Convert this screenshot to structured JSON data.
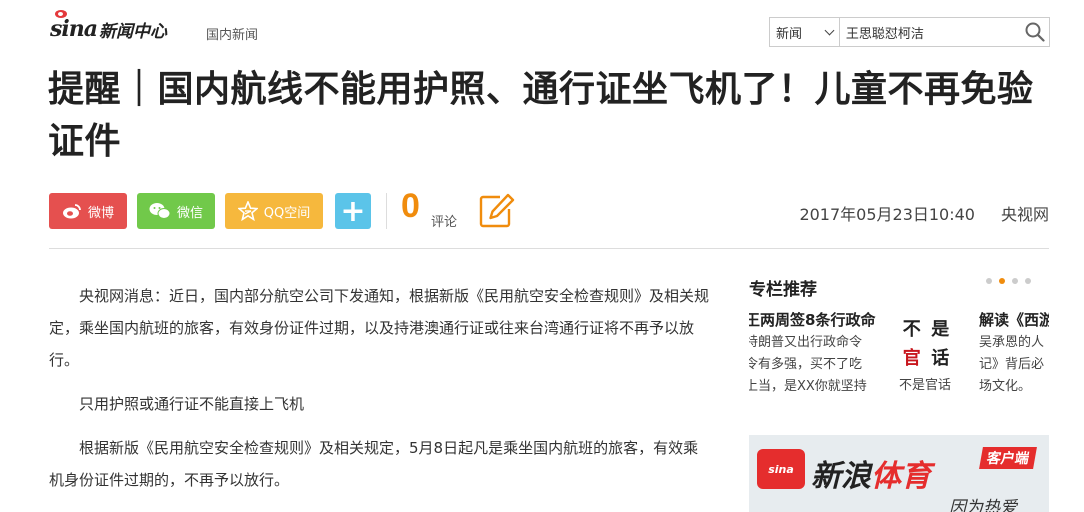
{
  "header": {
    "logo_text": "sina",
    "logo_title": "新闻中心",
    "nav_category": "国内新闻",
    "search": {
      "category": "新闻",
      "query": "王思聪怼柯洁"
    }
  },
  "article": {
    "title": "提醒｜国内航线不能用护照、通行证坐飞机了！儿童不再免验证件",
    "date": "2017年05月23日10:40",
    "source": "央视网",
    "comment_count": "0",
    "comment_label": "评论",
    "paragraphs": [
      "央视网消息：近日，国内部分航空公司下发通知，根据新版《民用航空安全检查规则》及相关规定，乘坐国内航班的旅客，有效身份证件过期，以及持港澳通行证或往来台湾通行证将不再予以放行。",
      "只用护照或通行证不能直接上飞机",
      "根据新版《民用航空安全检查规则》及相关规定，5月8日起凡是乘坐国内航班的旅客，有效乘机身份证件过期的，不再予以放行。"
    ]
  },
  "share": {
    "weibo": "微博",
    "wechat": "微信",
    "qzone": "QQ空间",
    "more": "+"
  },
  "sidebar": {
    "title": "专栏推荐",
    "cards": [
      {
        "headline": "王两周签8条行政命",
        "desc": [
          "特朗普又出行政命令",
          "令有多强，买不了吃",
          "上当，是XX你就坚持"
        ]
      },
      {
        "seal_chars": [
          "不",
          "是",
          "官",
          "话"
        ],
        "caption": "不是官话"
      },
      {
        "headline": "解读《西游",
        "desc": [
          "吴承恩的人",
          "记》背后必",
          "场文化。"
        ]
      }
    ],
    "banner": {
      "logo": "sina",
      "main_a": "新浪",
      "main_b": "体育",
      "tag": "客户端",
      "slogan": "因为热爱"
    }
  },
  "colors": {
    "weibo": "#e5504f",
    "wechat": "#71c94a",
    "qzone": "#f6b83d",
    "more": "#5bc4e9",
    "accent_orange": "#f08c0d",
    "brand_red": "#e52d2d"
  }
}
